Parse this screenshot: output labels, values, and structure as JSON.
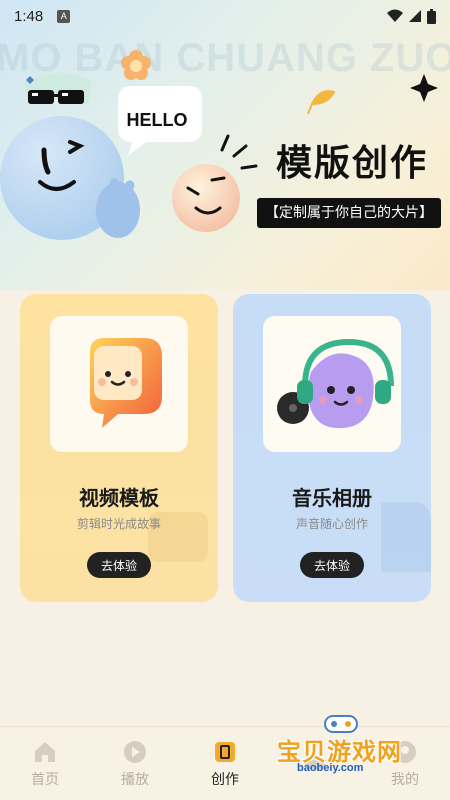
{
  "status_bar": {
    "time": "1:48",
    "notif_icon": "A"
  },
  "hero": {
    "watermark": "MO BAN CHUANG ZUO",
    "bubble": "HELLO",
    "title": "模版创作",
    "subtitle": "【定制属于你自己的大片】"
  },
  "cards": [
    {
      "title": "视频模板",
      "desc": "剪辑时光成故事",
      "button": "去体验",
      "icon": "video-template-icon"
    },
    {
      "title": "音乐相册",
      "desc": "声音随心创作",
      "button": "去体验",
      "icon": "music-album-icon"
    }
  ],
  "nav": {
    "items": [
      {
        "label": "首页",
        "icon": "home-icon"
      },
      {
        "label": "播放",
        "icon": "play-icon"
      },
      {
        "label": "创作",
        "icon": "create-icon",
        "active": true
      },
      {
        "label": "",
        "icon": "controller-icon"
      },
      {
        "label": "我的",
        "icon": "profile-icon"
      }
    ]
  },
  "site_watermark": {
    "name": "宝贝游戏网",
    "url": "baobeiy.com"
  },
  "colors": {
    "accent": "#222222",
    "video_card": "#fde2a0",
    "music_card": "#c6dcf7",
    "inactive": "#b5aea1"
  }
}
